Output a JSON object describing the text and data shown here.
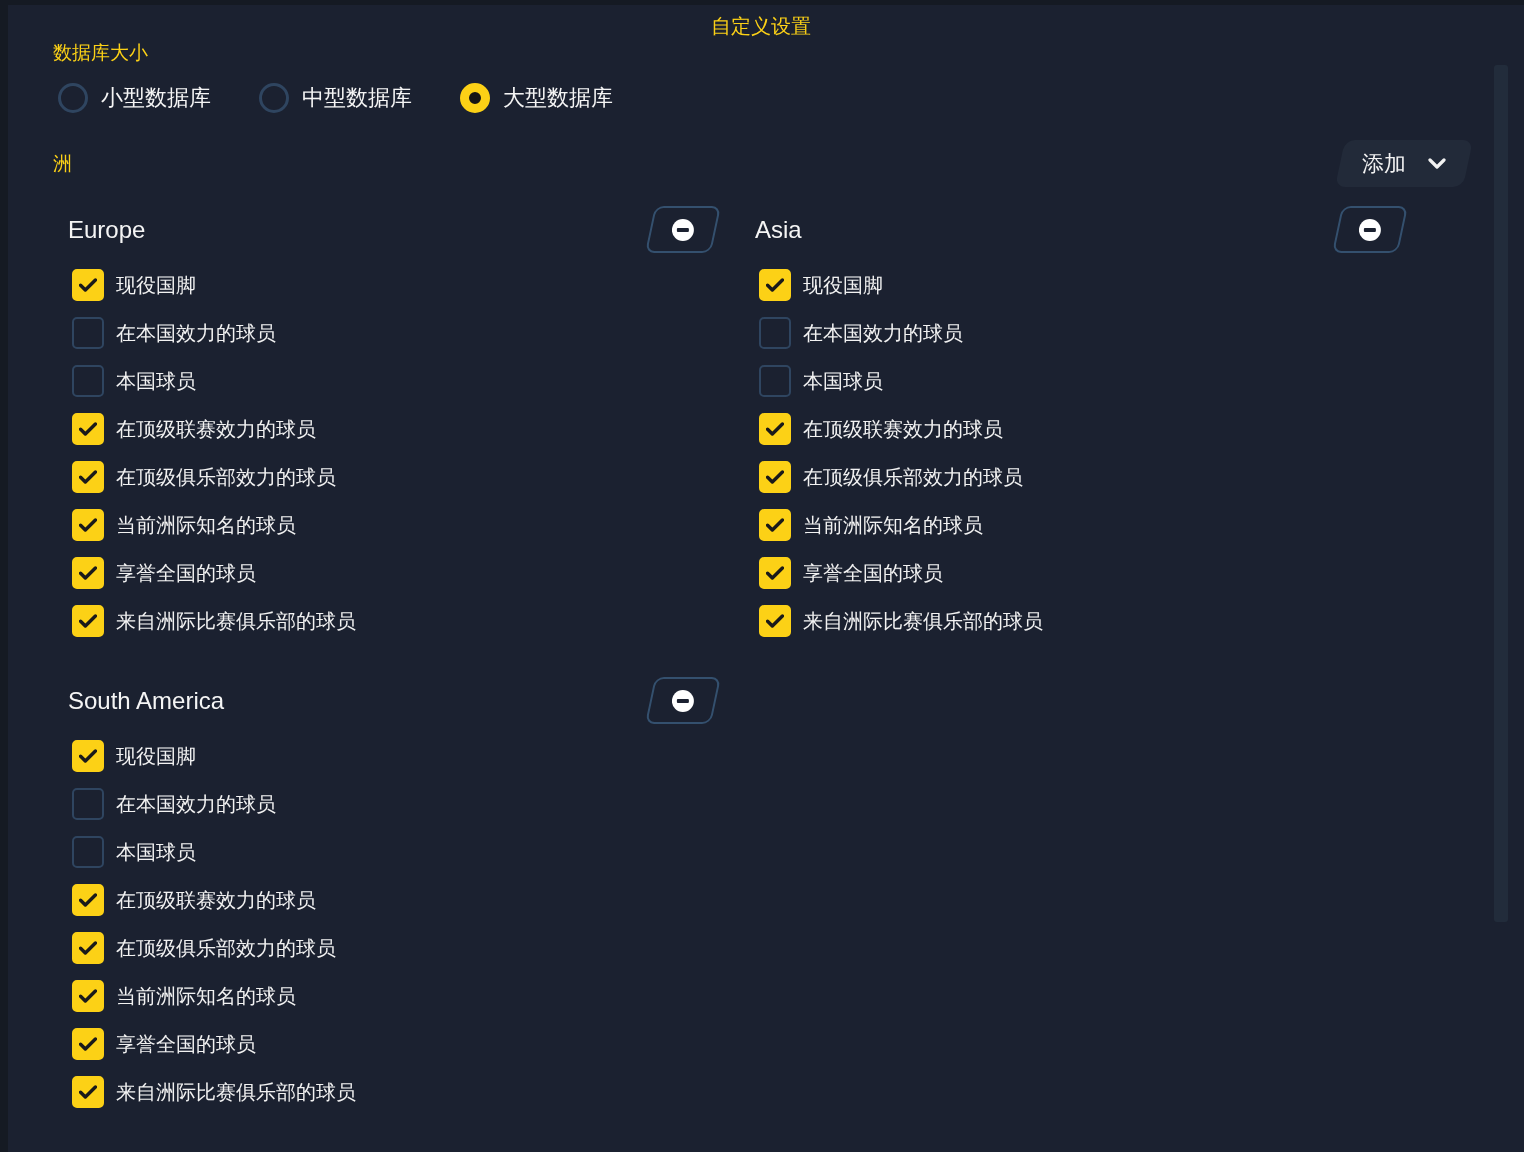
{
  "dialog": {
    "title": "自定义设置"
  },
  "database_size": {
    "label": "数据库大小",
    "options": [
      {
        "label": "小型数据库",
        "selected": false
      },
      {
        "label": "中型数据库",
        "selected": false
      },
      {
        "label": "大型数据库",
        "selected": true
      }
    ]
  },
  "continents": {
    "label": "洲",
    "add_button": {
      "label": "添加"
    },
    "items": [
      {
        "name": "Europe",
        "options": [
          {
            "label": "现役国脚",
            "checked": true
          },
          {
            "label": "在本国效力的球员",
            "checked": false
          },
          {
            "label": "本国球员",
            "checked": false
          },
          {
            "label": "在顶级联赛效力的球员",
            "checked": true
          },
          {
            "label": "在顶级俱乐部效力的球员",
            "checked": true
          },
          {
            "label": "当前洲际知名的球员",
            "checked": true
          },
          {
            "label": "享誉全国的球员",
            "checked": true
          },
          {
            "label": "来自洲际比赛俱乐部的球员",
            "checked": true
          }
        ]
      },
      {
        "name": "Asia",
        "options": [
          {
            "label": "现役国脚",
            "checked": true
          },
          {
            "label": "在本国效力的球员",
            "checked": false
          },
          {
            "label": "本国球员",
            "checked": false
          },
          {
            "label": "在顶级联赛效力的球员",
            "checked": true
          },
          {
            "label": "在顶级俱乐部效力的球员",
            "checked": true
          },
          {
            "label": "当前洲际知名的球员",
            "checked": true
          },
          {
            "label": "享誉全国的球员",
            "checked": true
          },
          {
            "label": "来自洲际比赛俱乐部的球员",
            "checked": true
          }
        ]
      },
      {
        "name": "South America",
        "options": [
          {
            "label": "现役国脚",
            "checked": true
          },
          {
            "label": "在本国效力的球员",
            "checked": false
          },
          {
            "label": "本国球员",
            "checked": false
          },
          {
            "label": "在顶级联赛效力的球员",
            "checked": true
          },
          {
            "label": "在顶级俱乐部效力的球员",
            "checked": true
          },
          {
            "label": "当前洲际知名的球员",
            "checked": true
          },
          {
            "label": "享誉全国的球员",
            "checked": true
          },
          {
            "label": "来自洲际比赛俱乐部的球员",
            "checked": true
          }
        ]
      }
    ]
  }
}
